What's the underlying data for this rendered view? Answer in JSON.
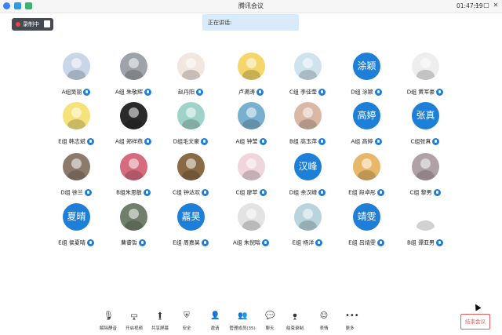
{
  "window": {
    "title": "腾讯会议",
    "time": "01:47:19",
    "controls": [
      "—",
      "□",
      "✕"
    ]
  },
  "recording": {
    "label": "录制中"
  },
  "speaking": {
    "label": "正在讲话:"
  },
  "participants": [
    {
      "name": "A组吴丽",
      "avatar_text": "",
      "avatar_color": "#c9d6e8"
    },
    {
      "name": "A组 朱敬辉",
      "avatar_text": "",
      "avatar_color": "#9da3a8"
    },
    {
      "name": "赵丹阳",
      "avatar_text": "",
      "avatar_color": "#f1e7de"
    },
    {
      "name": "卢满涛",
      "avatar_text": "",
      "avatar_color": "#f5d66a"
    },
    {
      "name": "C组 李佳莹",
      "avatar_text": "",
      "avatar_color": "#cfe3ef"
    },
    {
      "name": "D组 涂颖",
      "avatar_text": "涂颖",
      "avatar_color": "#1e7fd9"
    },
    {
      "name": "D组 黄军豪",
      "avatar_text": "",
      "avatar_color": "#eeeeee"
    },
    {
      "name": "E组 韩志斌",
      "avatar_text": "",
      "avatar_color": "#f6e27a"
    },
    {
      "name": "A组 郑祥燕",
      "avatar_text": "",
      "avatar_color": "#2a2a2a"
    },
    {
      "name": "D组毛文豪",
      "avatar_text": "",
      "avatar_color": "#9fd3c9"
    },
    {
      "name": "A组 钟莹",
      "avatar_text": "",
      "avatar_color": "#7ab0cf"
    },
    {
      "name": "B组 高玉萍",
      "avatar_text": "",
      "avatar_color": "#d9b8a6"
    },
    {
      "name": "A组 高婷",
      "avatar_text": "高婷",
      "avatar_color": "#1e7fd9"
    },
    {
      "name": "C组张真",
      "avatar_text": "张真",
      "avatar_color": "#1e7fd9"
    },
    {
      "name": "D组 徐兰",
      "avatar_text": "",
      "avatar_color": "#8c7b6b"
    },
    {
      "name": "B组朱思敏",
      "avatar_text": "",
      "avatar_color": "#d66b7d"
    },
    {
      "name": "C组 钟达欢",
      "avatar_text": "",
      "avatar_color": "#8a6a45"
    },
    {
      "name": "C组 廖苹",
      "avatar_text": "",
      "avatar_color": "#f0d6dc"
    },
    {
      "name": "D组 余汉峰",
      "avatar_text": "汉峰",
      "avatar_color": "#1e7fd9"
    },
    {
      "name": "E组 段卓彤",
      "avatar_text": "",
      "avatar_color": "#e8b86a"
    },
    {
      "name": "C组 黎男",
      "avatar_text": "",
      "avatar_color": "#b0a1a6"
    },
    {
      "name": "E组 侯夏晴",
      "avatar_text": "夏晴",
      "avatar_color": "#1e7fd9"
    },
    {
      "name": "曹睿哲",
      "avatar_text": "",
      "avatar_color": "#6f7f6a"
    },
    {
      "name": "E组 周嘉昊",
      "avatar_text": "嘉昊",
      "avatar_color": "#1e7fd9"
    },
    {
      "name": "A组 朱倪晗",
      "avatar_text": "",
      "avatar_color": "#e3e3e3"
    },
    {
      "name": "E组 杨洋",
      "avatar_text": "",
      "avatar_color": "#b9d4dc"
    },
    {
      "name": "E组 吕靖雯",
      "avatar_text": "靖雯",
      "avatar_color": "#1e7fd9"
    },
    {
      "name": "B组 谭亚男",
      "avatar_text": "",
      "avatar_color": "#ffffff"
    }
  ],
  "toolbar": {
    "items": [
      {
        "label": "解除静音",
        "icon": "mic-muted-icon",
        "glyph": "🎙"
      },
      {
        "label": "开启视频",
        "icon": "video-off-icon",
        "glyph": "▭"
      },
      {
        "label": "共享屏幕",
        "icon": "share-screen-icon",
        "glyph": "⬆"
      },
      {
        "label": "安全",
        "icon": "shield-icon",
        "glyph": "⛨"
      },
      {
        "label": "邀请",
        "icon": "invite-icon",
        "glyph": "👤"
      },
      {
        "label": "管理成员(35)",
        "icon": "members-icon",
        "glyph": "👥"
      },
      {
        "label": "聊天",
        "icon": "chat-icon",
        "glyph": "💬"
      },
      {
        "label": "结束录制",
        "icon": "record-stop-icon",
        "glyph": "⏺"
      },
      {
        "label": "表情",
        "icon": "emoji-icon",
        "glyph": "☺"
      },
      {
        "label": "更多",
        "icon": "more-icon",
        "glyph": "•••"
      }
    ],
    "end_label": "结束会议"
  }
}
